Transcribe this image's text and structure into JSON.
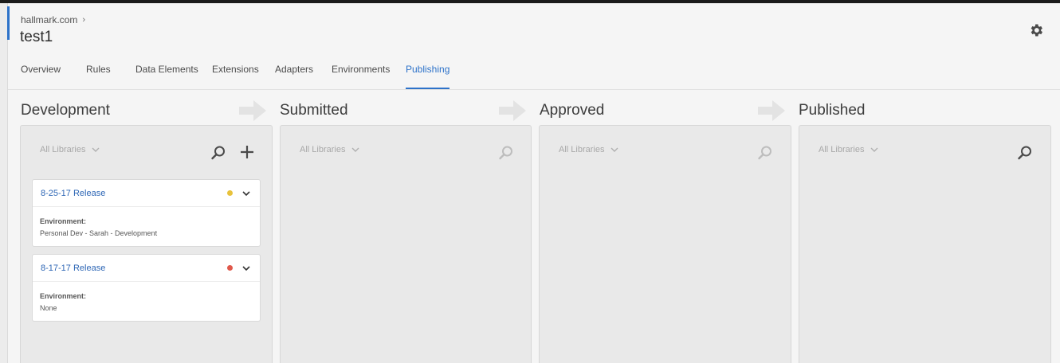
{
  "header": {
    "breadcrumb": "hallmark.com",
    "title": "test1"
  },
  "tabs": [
    {
      "label": "Overview"
    },
    {
      "label": "Rules"
    },
    {
      "label": "Data Elements"
    },
    {
      "label": "Extensions"
    },
    {
      "label": "Adapters"
    },
    {
      "label": "Environments"
    },
    {
      "label": "Publishing"
    }
  ],
  "active_tab": "Publishing",
  "columns": [
    {
      "title": "Development",
      "filter": "All Libraries",
      "libraries": [
        {
          "name": "8-25-17 Release",
          "status_color": "#e8c23c",
          "env_label": "Environment:",
          "env_value": "Personal Dev - Sarah - Development"
        },
        {
          "name": "8-17-17 Release",
          "status_color": "#e0584b",
          "env_label": "Environment:",
          "env_value": "None"
        }
      ]
    },
    {
      "title": "Submitted",
      "filter": "All Libraries",
      "libraries": []
    },
    {
      "title": "Approved",
      "filter": "All Libraries",
      "libraries": []
    },
    {
      "title": "Published",
      "filter": "All Libraries",
      "libraries": []
    }
  ],
  "icons": {
    "settings": "gear-icon",
    "search": "search-icon",
    "add": "plus-icon",
    "expand": "chevron-down-icon",
    "flow": "arrow-right-icon"
  },
  "colors": {
    "accent": "#2d72c9",
    "link": "#2d66b5"
  }
}
